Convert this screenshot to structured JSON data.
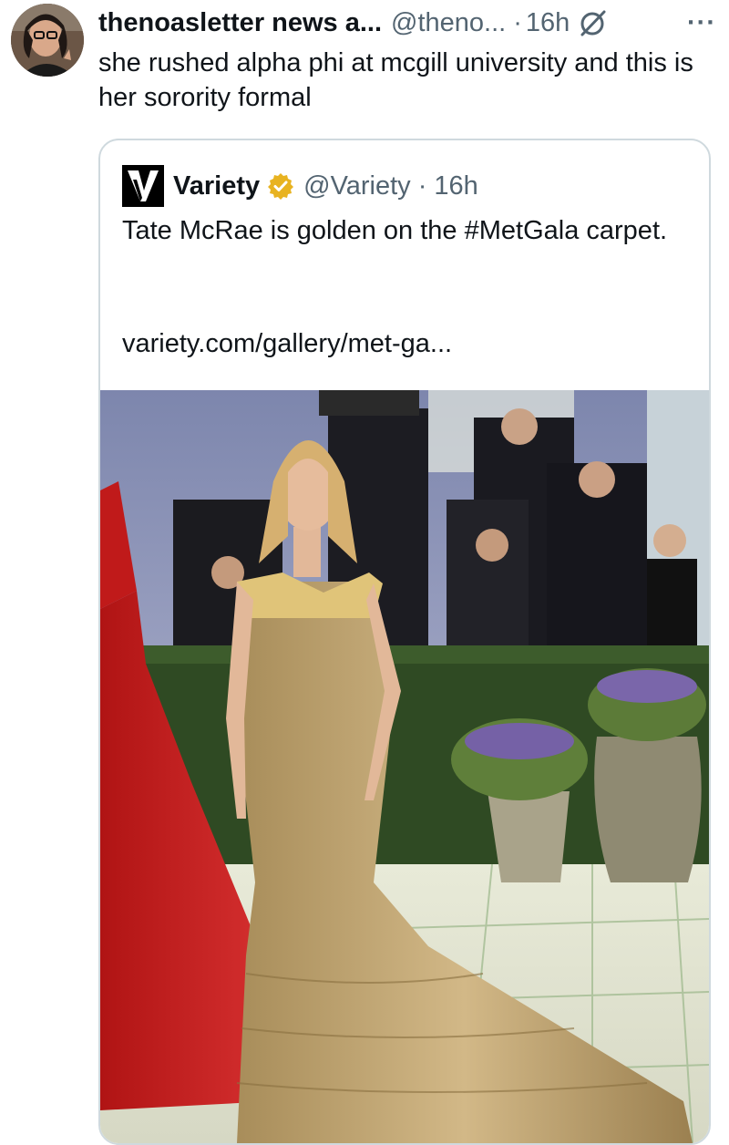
{
  "tweet": {
    "display_name": "thenoasletter news a...",
    "handle": "@theno...",
    "separator": "·",
    "time": "16h",
    "more": "···",
    "text": "she rushed alpha phi at mcgill university and this is her sorority formal"
  },
  "quoted": {
    "display_name": "Variety",
    "handle": "@Variety",
    "separator": "·",
    "time": "16h",
    "text": "Tate McRae is golden on the #MetGala carpet.",
    "link": "variety.com/gallery/met-ga...",
    "badge_color": "#e8b321"
  },
  "icons": {
    "avatar": "avatar-photo",
    "grok": "grok-icon",
    "more": "more-options-icon",
    "verified": "gold-verified-badge",
    "logo": "variety-logo"
  }
}
